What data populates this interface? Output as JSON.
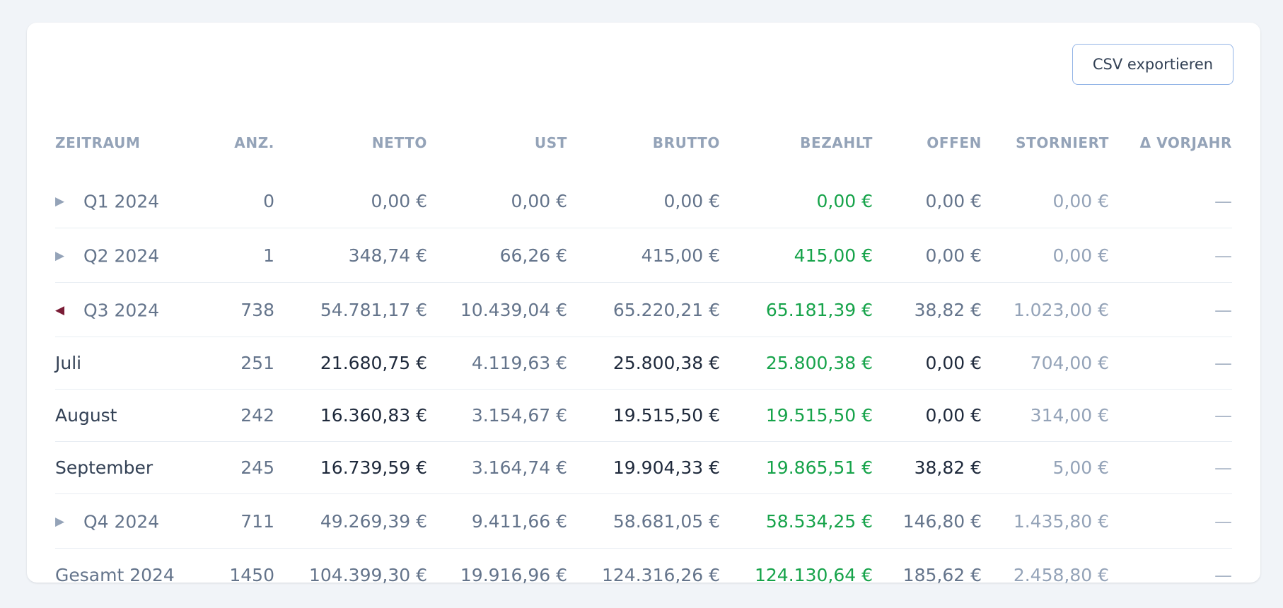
{
  "export_button": "CSV exportieren",
  "columns": [
    "ZEITRAUM",
    "ANZ.",
    "NETTO",
    "UST",
    "BRUTTO",
    "BEZAHLT",
    "OFFEN",
    "STORNIERT",
    "Δ VORJAHR"
  ],
  "rows": [
    {
      "label": "Q1 2024",
      "toggle": "▶",
      "count": "0",
      "netto": "0,00 €",
      "ust": "0,00 €",
      "brutto": "0,00 €",
      "bezahlt": "0,00 €",
      "offen": "0,00 €",
      "storniert": "0,00 €",
      "delta": "—"
    },
    {
      "label": "Q2 2024",
      "toggle": "▶",
      "count": "1",
      "netto": "348,74 €",
      "ust": "66,26 €",
      "brutto": "415,00 €",
      "bezahlt": "415,00 €",
      "offen": "0,00 €",
      "storniert": "0,00 €",
      "delta": "—"
    },
    {
      "label": "Q3 2024",
      "toggle": "◀",
      "count": "738",
      "netto": "54.781,17 €",
      "ust": "10.439,04 €",
      "brutto": "65.220,21 €",
      "bezahlt": "65.181,39 €",
      "offen": "38,82 €",
      "storniert": "1.023,00 €",
      "delta": "—"
    },
    {
      "label": "Juli",
      "count": "251",
      "netto": "21.680,75 €",
      "ust": "4.119,63 €",
      "brutto": "25.800,38 €",
      "bezahlt": "25.800,38 €",
      "offen": "0,00 €",
      "storniert": "704,00 €",
      "delta": "—"
    },
    {
      "label": "August",
      "count": "242",
      "netto": "16.360,83 €",
      "ust": "3.154,67 €",
      "brutto": "19.515,50 €",
      "bezahlt": "19.515,50 €",
      "offen": "0,00 €",
      "storniert": "314,00 €",
      "delta": "—"
    },
    {
      "label": "September",
      "count": "245",
      "netto": "16.739,59 €",
      "ust": "3.164,74 €",
      "brutto": "19.904,33 €",
      "bezahlt": "19.865,51 €",
      "offen": "38,82 €",
      "storniert": "5,00 €",
      "delta": "—"
    },
    {
      "label": "Q4 2024",
      "toggle": "▶",
      "count": "711",
      "netto": "49.269,39 €",
      "ust": "9.411,66 €",
      "brutto": "58.681,05 €",
      "bezahlt": "58.534,25 €",
      "offen": "146,80 €",
      "storniert": "1.435,80 €",
      "delta": "—"
    },
    {
      "label": "Gesamt 2024",
      "count": "1450",
      "netto": "104.399,30 €",
      "ust": "19.916,96 €",
      "brutto": "124.316,26 €",
      "bezahlt": "124.130,64 €",
      "offen": "185,62 €",
      "storniert": "2.458,80 €",
      "delta": "—"
    }
  ]
}
